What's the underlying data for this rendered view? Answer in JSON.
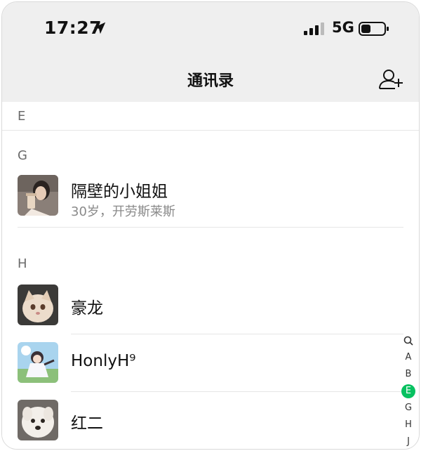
{
  "status_bar": {
    "time": "17:27",
    "network": "5G"
  },
  "nav": {
    "title": "通讯录",
    "add_icon": "add-contact-icon"
  },
  "sections": {
    "e": {
      "letter": "E"
    },
    "g": {
      "letter": "G"
    },
    "h": {
      "letter": "H"
    }
  },
  "contacts": [
    {
      "name": "隔壁的小姐姐",
      "subtitle": "30岁，开劳斯莱斯"
    },
    {
      "name": "豪龙"
    },
    {
      "name": "HonlyH⁹"
    },
    {
      "name": "红二"
    }
  ],
  "index_bar": [
    "A",
    "B",
    "E",
    "G",
    "H",
    "J"
  ],
  "index_active": "E",
  "colors": {
    "accent": "#07c160",
    "nav_bg": "#efefef"
  }
}
